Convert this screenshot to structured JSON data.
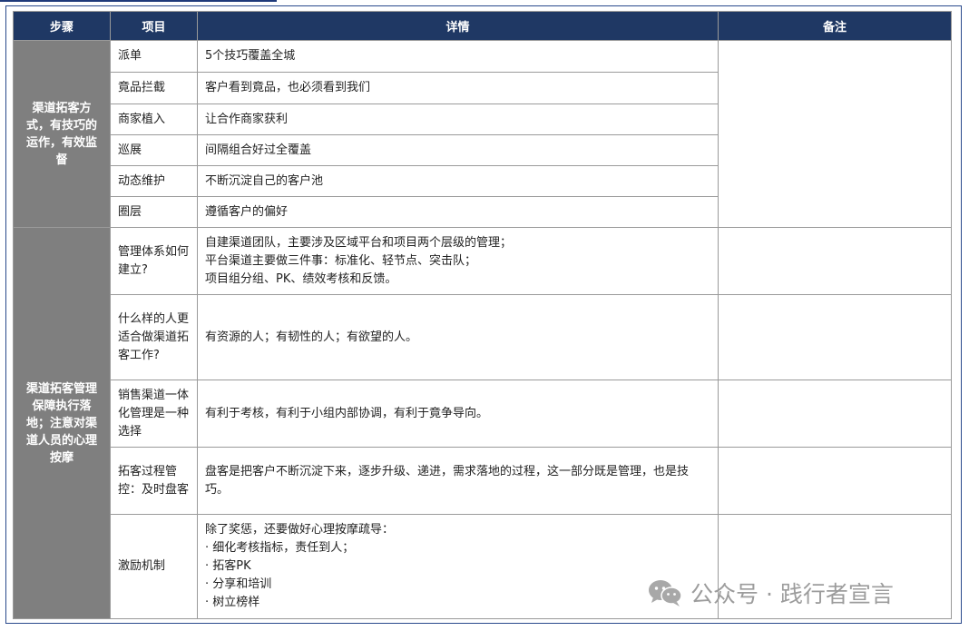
{
  "header": {
    "step": "步骤",
    "item": "项目",
    "detail": "详情",
    "note": "备注"
  },
  "sections": [
    {
      "step": "渠道拓客方式，有技巧的运作，有效监督",
      "rows": [
        {
          "item": "派单",
          "detail": [
            "5个技巧覆盖全城"
          ]
        },
        {
          "item": "竟品拦截",
          "detail": [
            "客户看到竟品，也必须看到我们"
          ]
        },
        {
          "item": "商家植入",
          "detail": [
            "让合作商家获利"
          ]
        },
        {
          "item": "巡展",
          "detail": [
            "间隔组合好过全覆盖"
          ]
        },
        {
          "item": "动态维护",
          "detail": [
            "不断沉淀自己的客户池"
          ]
        },
        {
          "item": "圈层",
          "detail": [
            "遵循客户的偏好"
          ]
        }
      ]
    },
    {
      "step": "渠道拓客管理保障执行落地；注意对渠道人员的心理按摩",
      "rows": [
        {
          "item": "管理体系如何建立?",
          "detail": [
            "自建渠道团队，主要涉及区域平台和项目两个层级的管理；",
            "平台渠道主要做三件事：标准化、轻节点、突击队；",
            "项目组分组、PK、绩效考核和反馈。"
          ]
        },
        {
          "item": "什么样的人更适合做渠道拓客工作?",
          "detail": [
            "有资源的人；有韧性的人；有欲望的人。"
          ]
        },
        {
          "item": "销售渠道一体化管理是一种选择",
          "detail": [
            "有利于考核，有利于小组内部协调，有利于竟争导向。"
          ]
        },
        {
          "item": "拓客过程管控：及时盘客",
          "detail": [
            "盘客是把客户不断沉淀下来，逐步升级、递进，需求落地的过程，这一部分既是管理，也是技巧。"
          ]
        },
        {
          "item": "激励机制",
          "detail": [
            "除了奖惩，还要做好心理按摩疏导：",
            "· 细化考核指标，责任到人；",
            "· 拓客PK",
            "· 分享和培训",
            "· 树立榜样"
          ]
        }
      ]
    }
  ],
  "watermark": {
    "text": "公众号 · 践行者宣言",
    "icon": "wechat-icon"
  }
}
